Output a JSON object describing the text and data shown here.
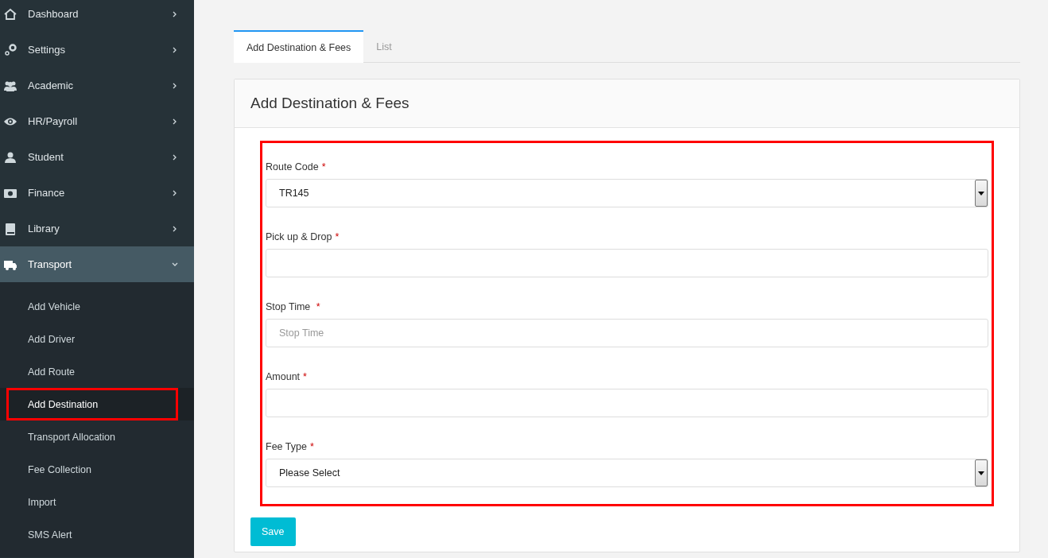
{
  "sidebar": {
    "items": [
      {
        "label": "Dashboard",
        "expanded": false
      },
      {
        "label": "Settings",
        "expanded": false
      },
      {
        "label": "Academic",
        "expanded": false
      },
      {
        "label": "HR/Payroll",
        "expanded": false
      },
      {
        "label": "Student",
        "expanded": false
      },
      {
        "label": "Finance",
        "expanded": false
      },
      {
        "label": "Library",
        "expanded": false
      },
      {
        "label": "Transport",
        "expanded": true,
        "children": [
          {
            "label": "Add Vehicle",
            "selected": false,
            "highlighted": false
          },
          {
            "label": "Add Driver",
            "selected": false,
            "highlighted": false
          },
          {
            "label": "Add Route",
            "selected": false,
            "highlighted": false
          },
          {
            "label": "Add Destination",
            "selected": true,
            "highlighted": true
          },
          {
            "label": "Transport Allocation",
            "selected": false,
            "highlighted": false
          },
          {
            "label": "Fee Collection",
            "selected": false,
            "highlighted": false
          },
          {
            "label": "Import",
            "selected": false,
            "highlighted": false
          },
          {
            "label": "SMS Alert",
            "selected": false,
            "highlighted": false
          }
        ]
      }
    ]
  },
  "tabs": [
    {
      "label": "Add Destination & Fees",
      "selected": true
    },
    {
      "label": "List",
      "selected": false
    }
  ],
  "panel": {
    "title": "Add Destination & Fees",
    "highlighted": true,
    "fields": [
      {
        "kind": "select",
        "label": "Route Code",
        "required": "*",
        "value": "TR145"
      },
      {
        "kind": "text",
        "label": "Pick up & Drop",
        "required": "*"
      },
      {
        "kind": "text",
        "label": "Stop Time ",
        "required": "*",
        "placeholder": "Stop Time"
      },
      {
        "kind": "text",
        "label": "Amount",
        "required": "*"
      },
      {
        "kind": "select",
        "label": "Fee Type",
        "required": "*",
        "value": "Please Select"
      }
    ],
    "save_button": "Save"
  }
}
